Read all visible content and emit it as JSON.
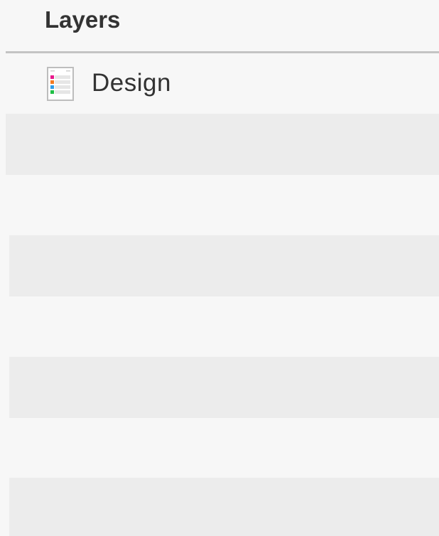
{
  "panel": {
    "title": "Layers"
  },
  "layers": [
    {
      "label": "Design",
      "icon": "document-layer-icon",
      "swatch_colors": [
        "#e8198b",
        "#f47a20",
        "#2e9de8",
        "#1fbf45"
      ]
    }
  ],
  "colors": {
    "background": "#f7f7f7",
    "row_shade": "#ececec",
    "divider": "#c4c4c4",
    "text": "#333333"
  }
}
